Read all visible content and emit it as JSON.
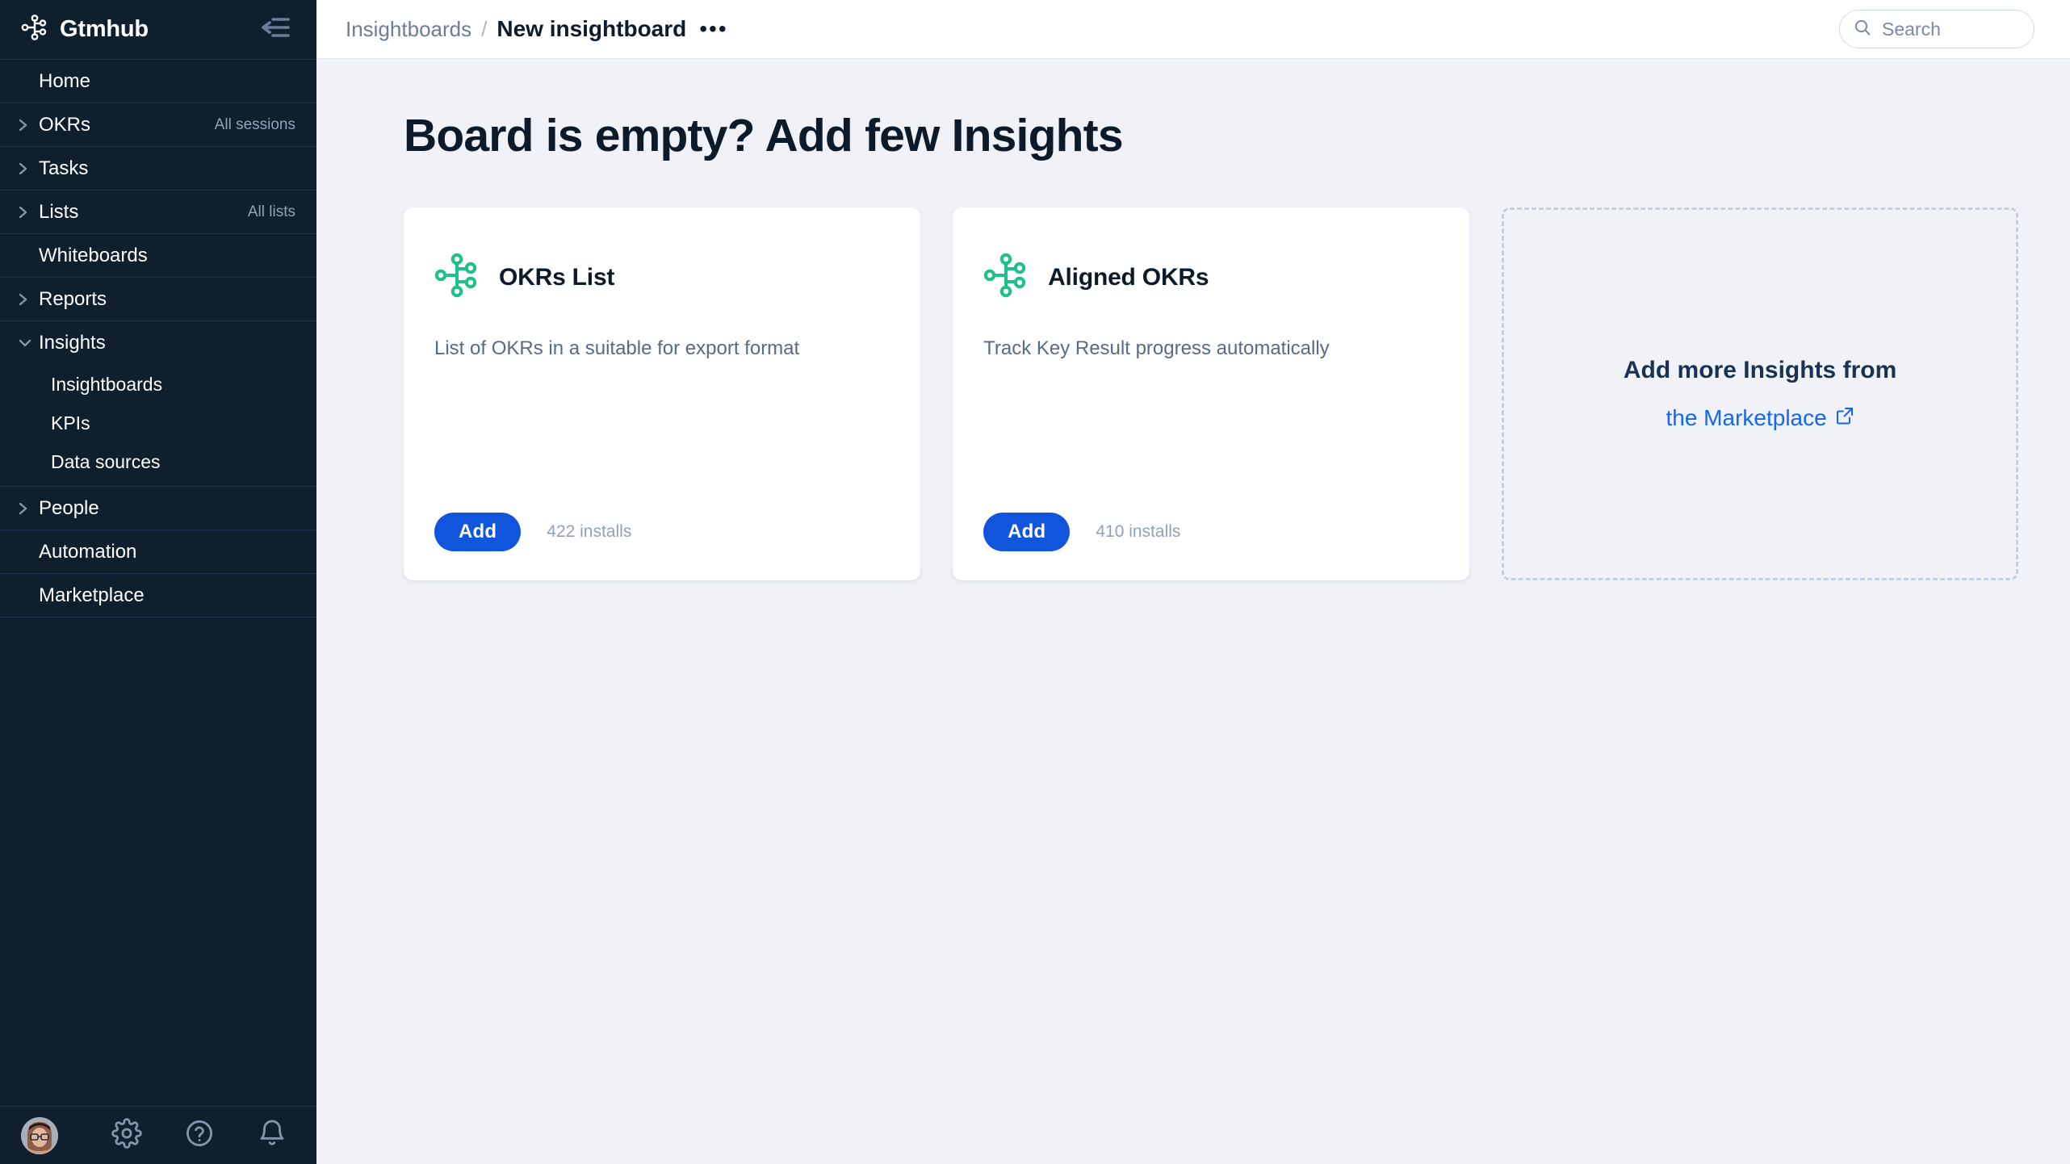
{
  "sidebar": {
    "brand": {
      "name": "Gtmhub",
      "logo_icon": "gtmhub-node-logo-icon"
    },
    "collapse_icon": "collapse-sidebar-icon",
    "items": [
      {
        "label": "Home",
        "meta": "",
        "expandable": false,
        "expanded": false,
        "level": 0
      },
      {
        "label": "OKRs",
        "meta": "All sessions",
        "expandable": true,
        "expanded": false,
        "level": 0
      },
      {
        "label": "Tasks",
        "meta": "",
        "expandable": true,
        "expanded": false,
        "level": 0
      },
      {
        "label": "Lists",
        "meta": "All lists",
        "expandable": true,
        "expanded": false,
        "level": 0
      },
      {
        "label": "Whiteboards",
        "meta": "",
        "expandable": false,
        "expanded": false,
        "level": 0
      },
      {
        "label": "Reports",
        "meta": "",
        "expandable": true,
        "expanded": false,
        "level": 0
      },
      {
        "label": "Insights",
        "meta": "",
        "expandable": true,
        "expanded": true,
        "level": 0
      }
    ],
    "insights_children": [
      {
        "label": "Insightboards"
      },
      {
        "label": "KPIs"
      },
      {
        "label": "Data sources"
      }
    ],
    "items_after": [
      {
        "label": "People",
        "meta": "",
        "expandable": true,
        "expanded": false,
        "level": 0
      },
      {
        "label": "Automation",
        "meta": "",
        "expandable": false,
        "expanded": false,
        "level": 0
      },
      {
        "label": "Marketplace",
        "meta": "",
        "expandable": false,
        "expanded": false,
        "level": 0
      }
    ],
    "footer": {
      "avatar_icon": "user-avatar",
      "settings_icon": "gear-icon",
      "help_icon": "question-circle-icon",
      "notifications_icon": "bell-icon"
    },
    "colors": {
      "background": "#0F1F2E",
      "divider": "#1E3047",
      "text": "#FFFFFF",
      "meta_text": "#93A2B8"
    }
  },
  "topbar": {
    "breadcrumb": {
      "parent": "Insightboards",
      "separator": "/",
      "current": "New insightboard",
      "more_label": "•••"
    },
    "search": {
      "placeholder": "Search",
      "icon": "search-icon"
    }
  },
  "main": {
    "title": "Board is empty? Add few Insights",
    "cards": [
      {
        "icon": "okr-node-graph-icon",
        "title": "OKRs List",
        "description": "List of OKRs in a suitable for export format",
        "add_label": "Add",
        "installs": "422 installs"
      },
      {
        "icon": "okr-node-graph-icon",
        "title": "Aligned OKRs",
        "description": "Track Key Result progress automatically",
        "add_label": "Add",
        "installs": "410 installs"
      }
    ],
    "placeholder": {
      "title": "Add more Insights from",
      "link_label": "the Marketplace",
      "link_icon": "external-link-icon"
    }
  },
  "colors": {
    "accent_blue": "#1155DD",
    "link_blue": "#1266F1",
    "icon_green": "#1FC08A",
    "page_background": "#F0F2F7",
    "card_background": "#FFFFFF",
    "heading_text": "#0C1A29"
  }
}
